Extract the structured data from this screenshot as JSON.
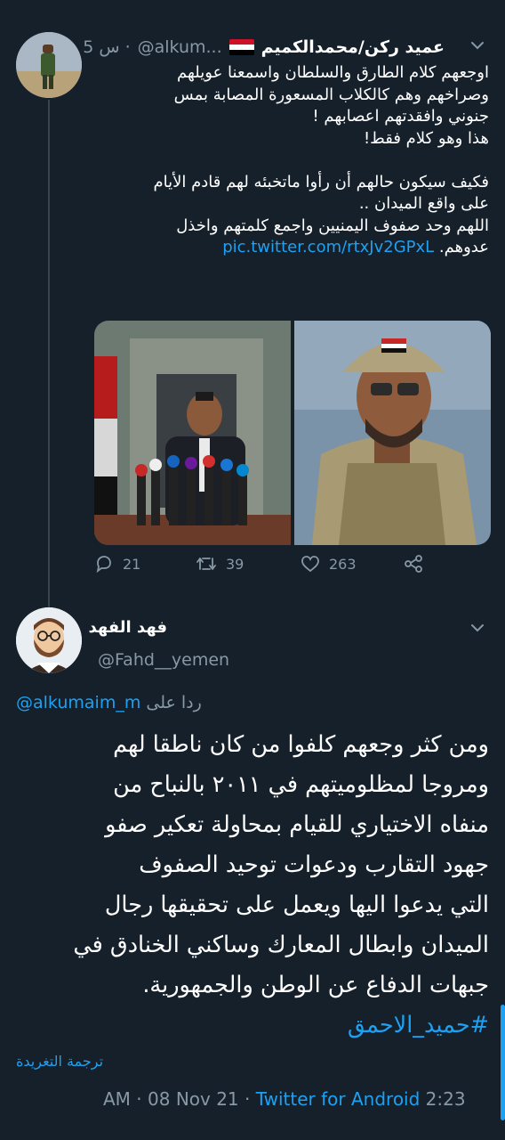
{
  "tweet": {
    "author_name": "عميد ركن/محمدالكميم",
    "handle": "@alkum...",
    "time": "5 س ·",
    "text_lines": [
      "اوجعهم كلام الطارق والسلطان واسمعنا عويلهم",
      "وصراخهم وهم كالكلاب المسعورة المصابة بمس",
      "جنوني وافقدتهم اعصابهم !",
      "هذا وهو كلام فقط!",
      "",
      "فكيف سيكون حالهم أن رأوا ماتخبئه لهم قادم الأيام",
      "على واقع الميدان ..",
      "اللهم وحد صفوف اليمنيين واجمع كلمتهم واخذل"
    ],
    "last_line_text": "عدوهم.",
    "link": "pic.twitter.com/rtxJv2GPxL",
    "replies": "21",
    "retweets": "39",
    "likes": "263"
  },
  "reply": {
    "author_name": "فهد الفهد",
    "handle": "@Fahd__yemen",
    "replying_to_label": "ردا على",
    "replying_to_handle": "@alkumaim_m",
    "text_lines": [
      "ومن كثر وجعهم كلفوا من كان ناطقا لهم",
      "ومروجا لمظلوميتهم في ٢٠١١ بالنباح من",
      "منفاه الاختياري للقيام بمحاولة تعكير صفو",
      "جهود التقارب ودعوات توحيد الصفوف",
      "التي يدعوا اليها ويعمل على تحقيقها رجال",
      "الميدان وابطال المعارك وساكني الخنادق في",
      "جبهات الدفاع عن الوطن والجمهورية."
    ],
    "hashtag": "#حميد_الاحمق",
    "translate_label": "ترجمة التغريدة",
    "time": "2:23",
    "date": "AM · 08 Nov 21 ·",
    "source": "Twitter for Android"
  },
  "icons": {
    "more": "chevron-down-icon",
    "reply": "reply-icon",
    "retweet": "retweet-icon",
    "like": "heart-icon",
    "share": "share-icon"
  },
  "colors": {
    "background": "#15202b",
    "accent": "#1da1f2",
    "muted": "#8899a6",
    "thread_line": "#38444d"
  }
}
